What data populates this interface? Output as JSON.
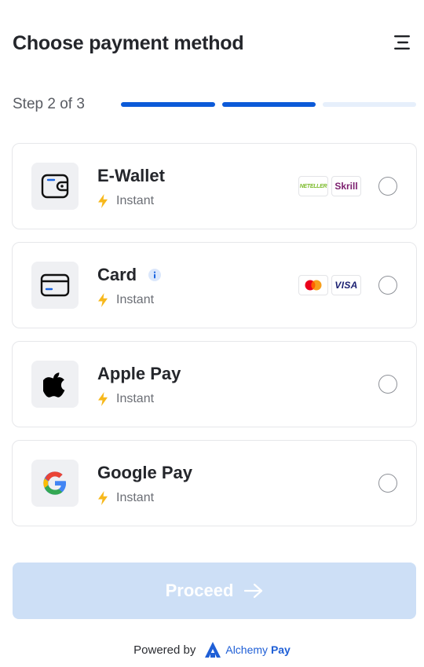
{
  "header": {
    "title": "Choose payment method",
    "menu_icon": "menu-icon"
  },
  "progress": {
    "step_label": "Step 2 of 3",
    "current_step": 2,
    "total_steps": 3,
    "active_color": "#0c5ad8",
    "inactive_color": "#e6effb"
  },
  "methods": [
    {
      "name": "E-Wallet",
      "speed": "Instant",
      "icon": "wallet-icon",
      "brands": [
        "NETELLER",
        "Skrill"
      ],
      "selected": false
    },
    {
      "name": "Card",
      "speed": "Instant",
      "icon": "credit-card-icon",
      "has_info": true,
      "brands": [
        "mastercard",
        "VISA"
      ],
      "selected": false
    },
    {
      "name": "Apple Pay",
      "speed": "Instant",
      "icon": "apple-icon",
      "brands": [],
      "selected": false
    },
    {
      "name": "Google Pay",
      "speed": "Instant",
      "icon": "google-icon",
      "brands": [],
      "selected": false
    }
  ],
  "actions": {
    "proceed_label": "Proceed",
    "proceed_disabled": true,
    "proceed_color": "#cddff6"
  },
  "footer": {
    "powered_by": "Powered by",
    "brand_part1": "Alchemy",
    "brand_part2": "Pay",
    "brand_color": "#1f5fd6"
  }
}
